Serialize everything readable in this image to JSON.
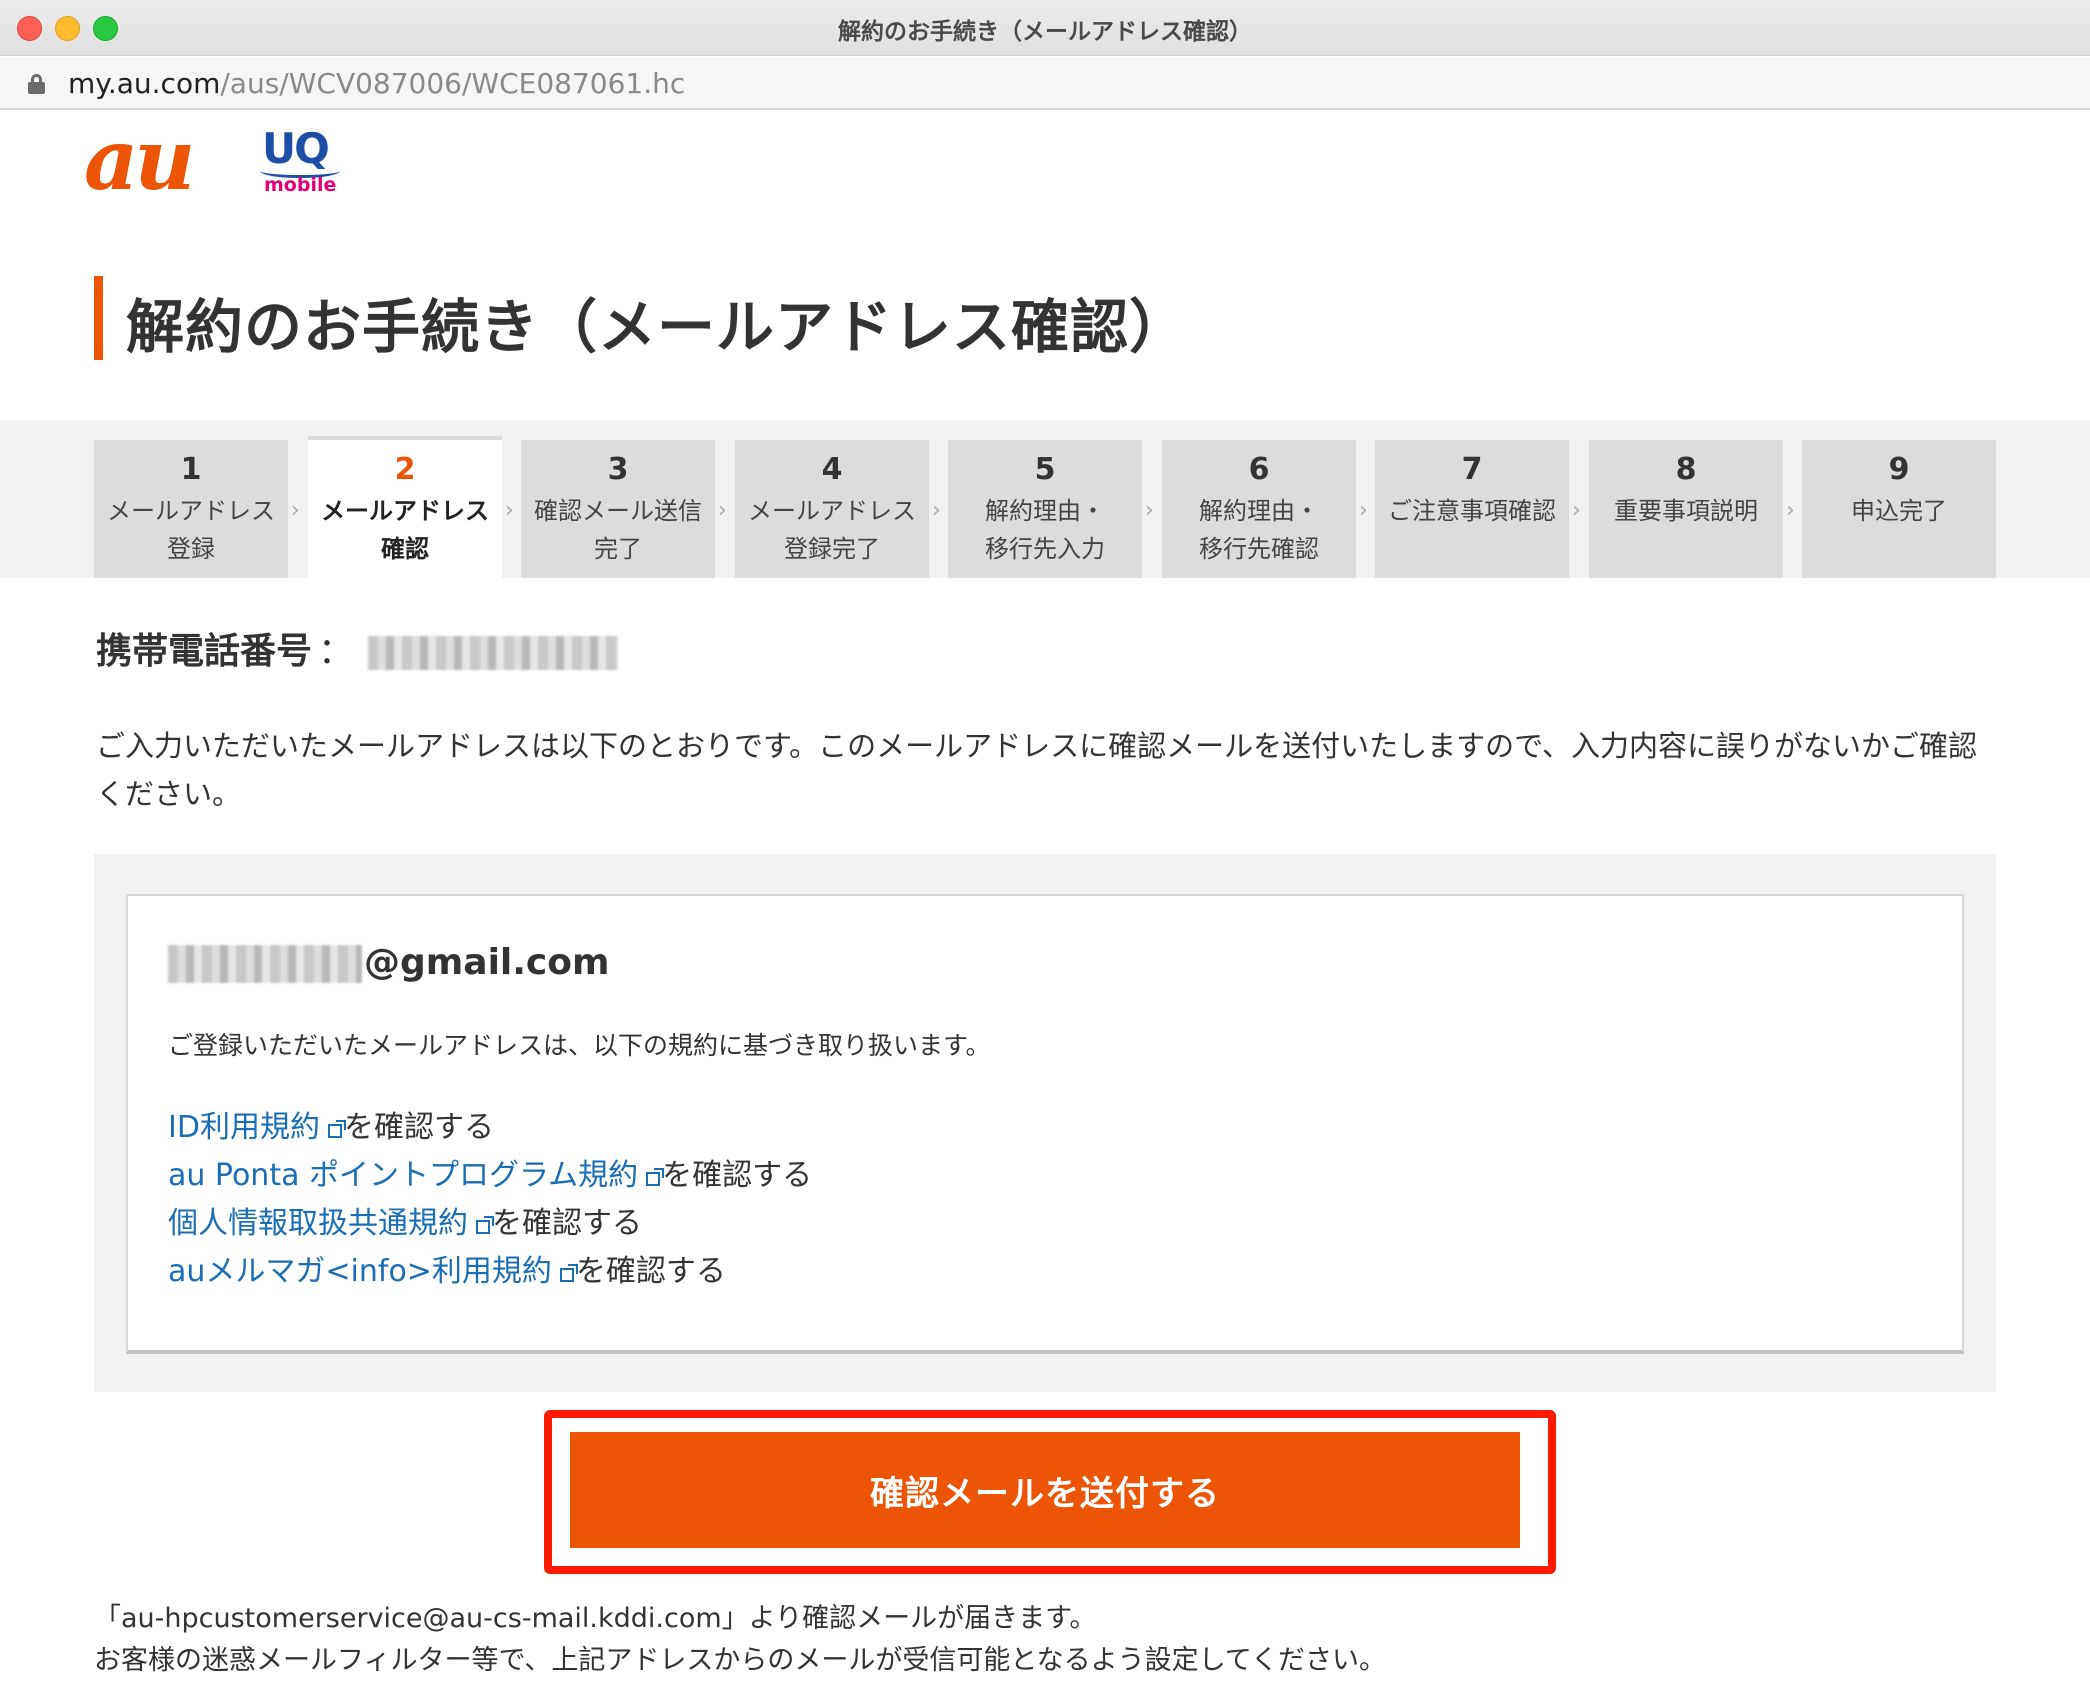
{
  "browser": {
    "window_title": "解約のお手続き（メールアドレス確認）",
    "url_host": "my.au.com",
    "url_path": "/aus/WCV087006/WCE087061.hc"
  },
  "brand": {
    "au_logo": "au",
    "uq_logo": "UQ",
    "uq_sub": "mobile",
    "accent_color": "#eb5505",
    "link_color": "#1a6eb5"
  },
  "page": {
    "title": "解約のお手続き（メールアドレス確認）"
  },
  "steps": [
    {
      "num": "1",
      "label": "メールアドレス\n登録",
      "current": false
    },
    {
      "num": "2",
      "label": "メールアドレス\n確認",
      "current": true
    },
    {
      "num": "3",
      "label": "確認メール送信\n完了",
      "current": false
    },
    {
      "num": "4",
      "label": "メールアドレス\n登録完了",
      "current": false
    },
    {
      "num": "5",
      "label": "解約理由・\n移行先入力",
      "current": false
    },
    {
      "num": "6",
      "label": "解約理由・\n移行先確認",
      "current": false
    },
    {
      "num": "7",
      "label": "ご注意事項確認",
      "current": false
    },
    {
      "num": "8",
      "label": "重要事項説明",
      "current": false
    },
    {
      "num": "9",
      "label": "申込完了",
      "current": false
    }
  ],
  "phone": {
    "label": "携帯電話番号",
    "colon": "："
  },
  "intro": "ご入力いただいたメールアドレスは以下のとおりです。このメールアドレスに確認メールを送付いたしますので、入力内容に誤りがないかご確認ください。",
  "confirm": {
    "email_domain": "@gmail.com",
    "policy_note": "ご登録いただいたメールアドレスは、以下の規約に基づき取り扱います。",
    "links": [
      {
        "text": "ID利用規約",
        "suffix": "を確認する"
      },
      {
        "text": "au Ponta ポイントプログラム規約",
        "suffix": "を確認する"
      },
      {
        "text": "個人情報取扱共通規約",
        "suffix": "を確認する"
      },
      {
        "text": "auメルマガ<info>利用規約",
        "suffix": "を確認する"
      }
    ]
  },
  "send_button": "確認メールを送付する",
  "footer": {
    "line1": "「au-hpcustomerservice@au-cs-mail.kddi.com」より確認メールが届きます。",
    "line2": "お客様の迷惑メールフィルター等で、上記アドレスからのメールが受信可能となるよう設定してください。"
  }
}
